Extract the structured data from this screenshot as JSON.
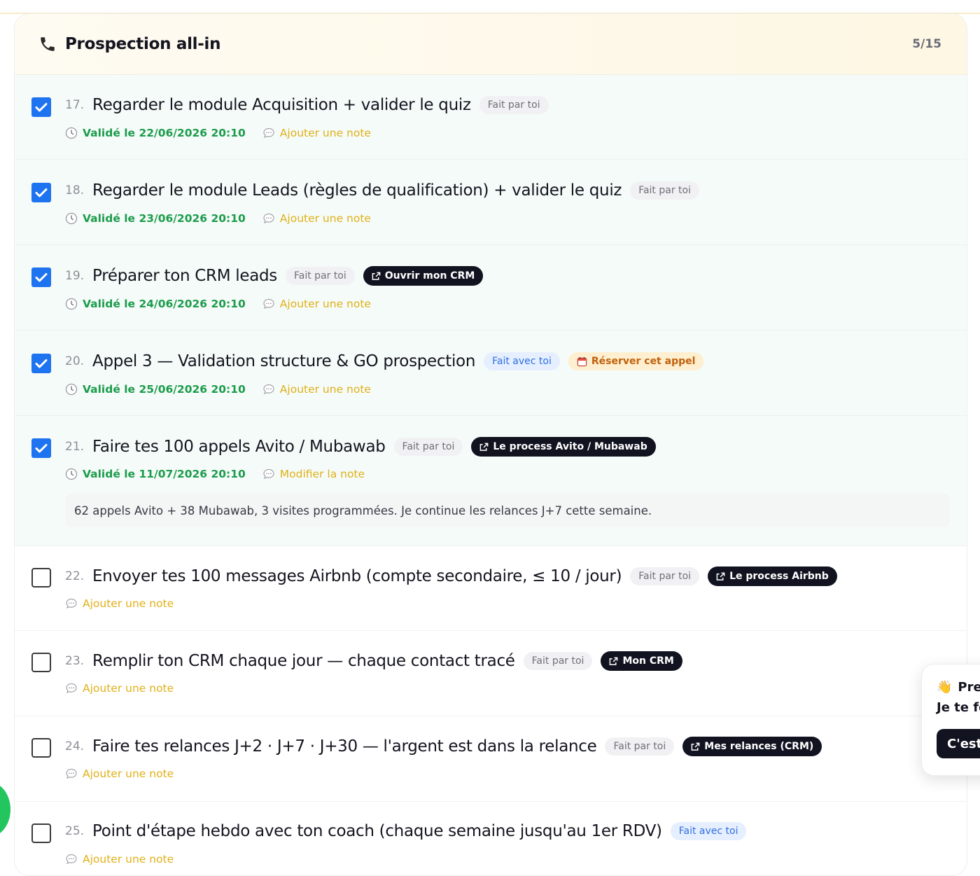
{
  "section": {
    "title": "Prospection all-in",
    "count": "5/15",
    "icon": "phone-icon"
  },
  "tasks": [
    {
      "num": "17.",
      "title": "Regarder le module Acquisition + valider le quiz",
      "checked": true,
      "tag": "Fait par toi",
      "validated": "Validé le 22/06/2026 20:10",
      "note_link": "Ajouter une note"
    },
    {
      "num": "18.",
      "title": "Regarder le module Leads (règles de qualification) + valider le quiz",
      "checked": true,
      "tag": "Fait par toi",
      "validated": "Validé le 23/06/2026 20:10",
      "note_link": "Ajouter une note"
    },
    {
      "num": "19.",
      "title": "Préparer ton CRM leads",
      "checked": true,
      "tag": "Fait par toi",
      "action": "Ouvrir mon CRM",
      "validated": "Validé le 24/06/2026 20:10",
      "note_link": "Ajouter une note"
    },
    {
      "num": "20.",
      "title": "Appel 3 — Validation structure & GO prospection",
      "checked": true,
      "tag": "Fait avec toi",
      "action": "Réserver cet appel",
      "validated": "Validé le 25/06/2026 20:10",
      "note_link": "Ajouter une note"
    },
    {
      "num": "21.",
      "title": "Faire tes 100 appels Avito / Mubawab",
      "checked": true,
      "tag": "Fait par toi",
      "action": "Le process Avito / Mubawab",
      "validated": "Validé le 11/07/2026 20:10",
      "note_link": "Modifier la note",
      "note": "62 appels Avito + 38 Mubawab, 3 visites programmées. Je continue les relances J+7 cette semaine."
    },
    {
      "num": "22.",
      "title": "Envoyer tes 100 messages Airbnb (compte secondaire, ≤ 10 / jour)",
      "checked": false,
      "tag": "Fait par toi",
      "action": "Le process Airbnb",
      "note_link": "Ajouter une note"
    },
    {
      "num": "23.",
      "title": "Remplir ton CRM chaque jour — chaque contact tracé",
      "checked": false,
      "tag": "Fait par toi",
      "action": "Mon CRM",
      "note_link": "Ajouter une note"
    },
    {
      "num": "24.",
      "title": "Faire tes relances J+2 · J+7 · J+30 — l'argent est dans la relance",
      "checked": false,
      "tag": "Fait par toi",
      "action": "Mes relances (CRM)",
      "note_link": "Ajouter une note"
    },
    {
      "num": "25.",
      "title": "Point d'étape hebdo avec ton coach (chaque semaine jusqu'au 1er RDV)",
      "checked": false,
      "tag": "Fait avec toi",
      "note_link": "Ajouter une note"
    }
  ],
  "popup": {
    "emoji": "👋",
    "line1": "Pre",
    "line2": "Je te fo",
    "button": "C'est"
  },
  "colors": {
    "checkbox": "#1e73f0",
    "validated": "#1c9c4c",
    "note_link": "#e0b018",
    "dark_chip": "#111320",
    "header_bg": "#fdf7e3",
    "done_row_bg": "#f5fbf8"
  }
}
